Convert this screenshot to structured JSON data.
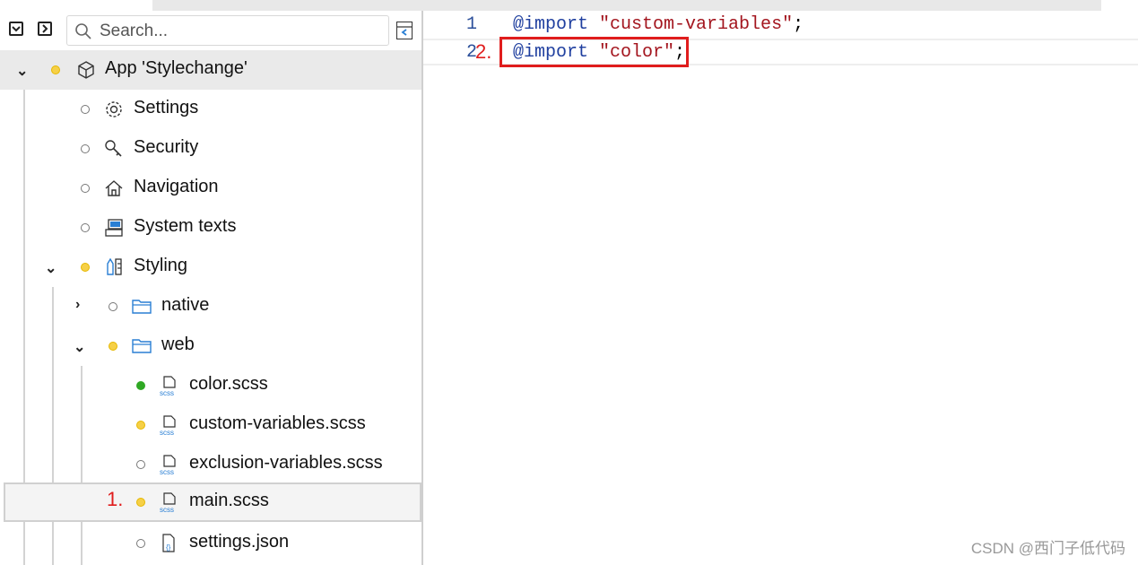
{
  "search": {
    "placeholder": "Search..."
  },
  "tree": {
    "app": "App 'Stylechange'",
    "settings": "Settings",
    "security": "Security",
    "navigation": "Navigation",
    "system_texts": "System texts",
    "styling": "Styling",
    "native": "native",
    "web": "web",
    "color_scss": "color.scss",
    "custom_variables": "custom-variables.scss",
    "exclusion_variables": "exclusion-variables.scss",
    "main_scss": "main.scss",
    "settings_json": "settings.json"
  },
  "editor": {
    "lines": [
      {
        "num": "1",
        "kw": "@import",
        "str": "\"custom-variables\"",
        "end": ";"
      },
      {
        "num": "2",
        "kw": "@import",
        "str": "\"color\"",
        "end": ";"
      }
    ]
  },
  "annotations": {
    "a1": "1.",
    "a2": "2."
  },
  "watermark": "CSDN @西门子低代码",
  "colors": {
    "keyword": "#1f3f9f",
    "string": "#a3151e",
    "annotation": "#e01d1d",
    "modified": "#f6d047",
    "added": "#2fa824"
  }
}
